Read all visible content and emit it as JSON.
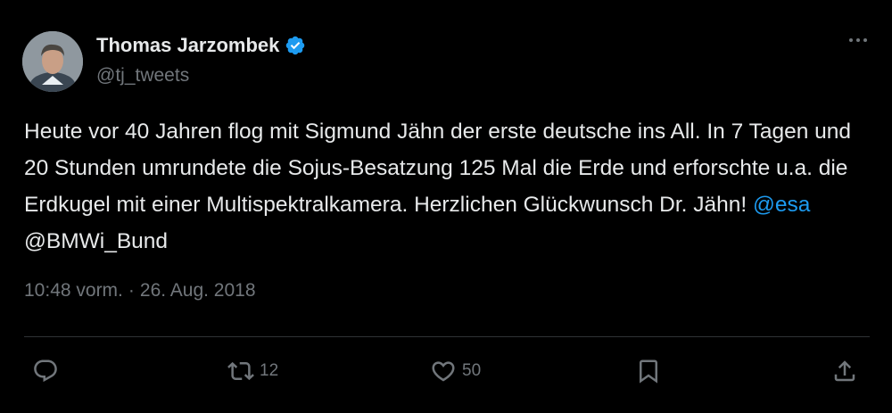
{
  "author": {
    "name": "Thomas Jarzombek",
    "handle": "@tj_tweets",
    "verified": true
  },
  "tweet": {
    "text_segments": [
      {
        "text": "Heute vor 40 Jahren flog mit Sigmund Jähn der erste deutsche ins All. In 7 Tagen und 20 Stunden umrundete die Sojus-Besatzung 125 Mal die Erde und erforschte u.a. die Erdkugel mit einer Multispektralkamera. Herzlichen Glückwunsch Dr. Jähn! ",
        "link": false
      },
      {
        "text": "@esa",
        "link": true
      },
      {
        "text": " @BMWi_Bund",
        "link": false
      }
    ],
    "time": "10:48 vorm.",
    "separator": "·",
    "date": "26. Aug. 2018"
  },
  "actions": {
    "reply_icon": "reply-icon",
    "retweet_icon": "retweet-icon",
    "retweet_count": "12",
    "like_icon": "heart-icon",
    "like_count": "50",
    "bookmark_icon": "bookmark-icon",
    "share_icon": "share-icon"
  },
  "colors": {
    "background": "#000000",
    "text": "#e7e9ea",
    "secondary": "#71767b",
    "link": "#1d9bf0",
    "verified": "#1d9bf0",
    "divider": "#2f3336"
  }
}
